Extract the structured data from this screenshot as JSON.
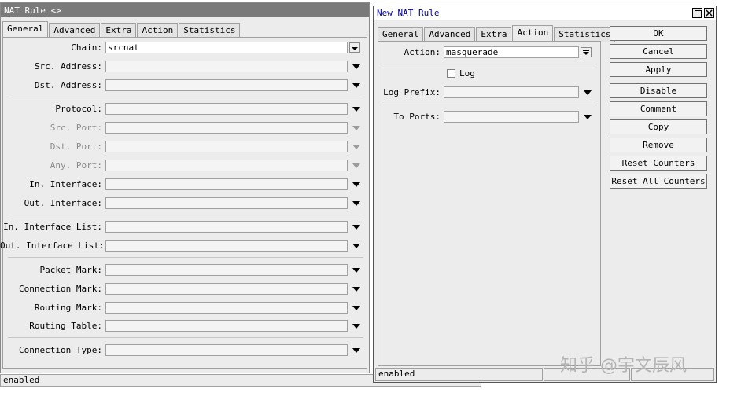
{
  "bg_window": {
    "title": "NAT Rule <>",
    "tabs": [
      "General",
      "Advanced",
      "Extra",
      "Action",
      "Statistics"
    ],
    "active_tab": "General",
    "fields": {
      "chain": {
        "label": "Chain:",
        "value": "srcnat"
      },
      "src_address": {
        "label": "Src. Address:"
      },
      "dst_address": {
        "label": "Dst. Address:"
      },
      "protocol": {
        "label": "Protocol:"
      },
      "src_port": {
        "label": "Src. Port:"
      },
      "dst_port": {
        "label": "Dst. Port:"
      },
      "any_port": {
        "label": "Any. Port:"
      },
      "in_interface": {
        "label": "In. Interface:"
      },
      "out_interface": {
        "label": "Out. Interface:"
      },
      "in_interface_list": {
        "label": "In. Interface List:"
      },
      "out_interface_list": {
        "label": "Out. Interface List:"
      },
      "packet_mark": {
        "label": "Packet Mark:"
      },
      "connection_mark": {
        "label": "Connection Mark:"
      },
      "routing_mark": {
        "label": "Routing Mark:"
      },
      "routing_table": {
        "label": "Routing Table:"
      },
      "connection_type": {
        "label": "Connection Type:"
      }
    },
    "status": "enabled"
  },
  "dialog": {
    "title": "New NAT Rule",
    "tabs": [
      "General",
      "Advanced",
      "Extra",
      "Action",
      "Statistics"
    ],
    "active_tab": "Action",
    "action": {
      "label": "Action:",
      "value": "masquerade"
    },
    "log": {
      "label": "Log",
      "checked": false
    },
    "log_prefix": {
      "label": "Log Prefix:"
    },
    "to_ports": {
      "label": "To Ports:"
    },
    "buttons": [
      "OK",
      "Cancel",
      "Apply",
      "Disable",
      "Comment",
      "Copy",
      "Remove",
      "Reset Counters",
      "Reset All Counters"
    ],
    "status": "enabled"
  },
  "watermark": "知乎 @宇文辰风",
  "colors": {
    "title_active": "#000080",
    "title_inactive": "#7a7a7a",
    "window_bg": "#ececec"
  }
}
